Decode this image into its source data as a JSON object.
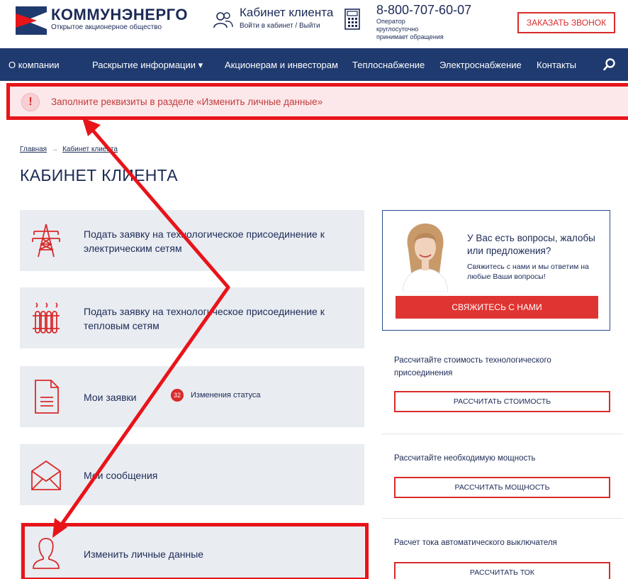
{
  "header": {
    "brand_name": "КОММУНЭНЕРГО",
    "brand_sub": "Открытое акционерное общество",
    "cabinet_title": "Кабинет клиента",
    "cabinet_sub": "Войти в кабинет / Выйти",
    "phone": "8-800-707-60-07",
    "phone_sub": "Оператор круглосуточно принимает обращения",
    "call_button": "ЗАКАЗАТЬ ЗВОНОК"
  },
  "nav": {
    "items": [
      {
        "label": "О компании"
      },
      {
        "label": "Раскрытие информации ▾"
      },
      {
        "label": "Акционерам и инвесторам"
      },
      {
        "label": "Теплоснабжение"
      },
      {
        "label": "Электроснабжение"
      },
      {
        "label": "Контакты"
      }
    ],
    "search_icon": "search-icon"
  },
  "alert": {
    "icon": "!",
    "text": "Заполните реквизиты в разделе «Изменить личные данные»"
  },
  "breadcrumb": {
    "home": "Главная",
    "separator": "→",
    "current": "Кабинет клиента"
  },
  "page_title": "КАБИНЕТ КЛИЕНТА",
  "cards": [
    {
      "label": "Подать заявку на технологическое присоединение к электрическим сетям",
      "icon": "power-tower-icon"
    },
    {
      "label": "Подать заявку на технологическое присоединение к тепловым сетям",
      "icon": "radiator-icon"
    },
    {
      "label": "Мои заявки",
      "icon": "document-icon",
      "badge_count": "32",
      "badge_label": "Изменения статуса"
    },
    {
      "label": "Мои сообщения",
      "icon": "envelope-icon"
    },
    {
      "label": "Изменить личные данные",
      "icon": "user-icon"
    }
  ],
  "help": {
    "title": "У Вас есть вопросы, жалобы или предложения?",
    "text": "Свяжитесь с нами и мы ответим на любые Ваши вопросы!",
    "button": "СВЯЖИТЕСЬ С НАМИ"
  },
  "calculators": [
    {
      "text": "Рассчитайте стоимость технологического присоединения",
      "button": "РАССЧИТАТЬ СТОИМОСТЬ"
    },
    {
      "text": "Рассчитайте необходимую мощность",
      "button": "РАССЧИТАТЬ МОЩНОСТЬ"
    },
    {
      "text": "Расчет тока автоматического выключателя",
      "button": "РАССЧИТАТЬ ТОК"
    }
  ],
  "colors": {
    "nav_bg": "#1f3a6e",
    "accent_red": "#d92b2b",
    "highlight_red": "#e8141a",
    "card_bg": "#e9ecf1",
    "alert_bg": "#fce8ea"
  }
}
